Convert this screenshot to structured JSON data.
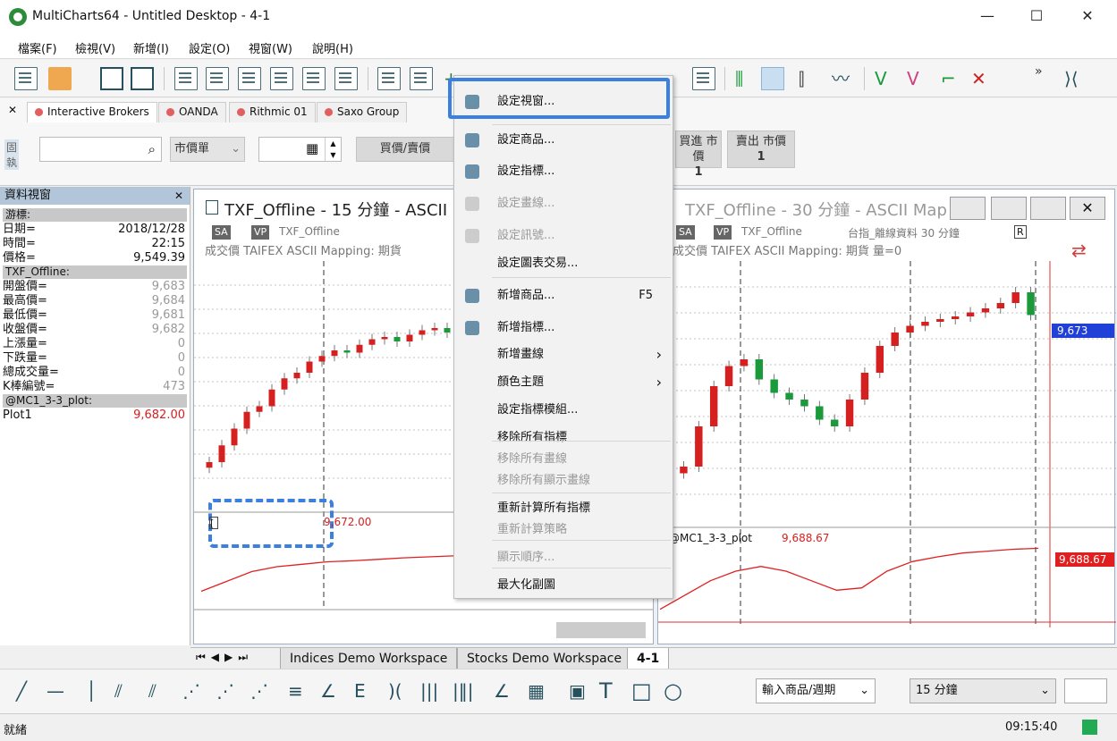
{
  "window": {
    "title": "MultiCharts64 - Untitled Desktop - 4-1",
    "minimize": "—",
    "maximize": "☐",
    "close": "✕"
  },
  "menubar": [
    "檔案(F)",
    "檢視(V)",
    "新增(I)",
    "設定(O)",
    "視窗(W)",
    "說明(H)"
  ],
  "toolbar": {
    "more_glyph": "»"
  },
  "orderbar": {
    "close_glyph": "✕",
    "side_label": "固執",
    "broker_tabs": [
      "Interactive Brokers",
      "OANDA",
      "Rithmic 01",
      "Saxo Group"
    ],
    "order_type": "市價單",
    "buy_sell": "買價/賣價",
    "buy_market": "買進 市價",
    "buy_qty": "1",
    "sell_market": "賣出 市價",
    "sell_qty": "1"
  },
  "datawin": {
    "title": "資料視窗",
    "close_glyph": "✕",
    "cursor_section": "游標:",
    "cursor_rows": [
      {
        "label": "日期=",
        "value": "2018/12/28"
      },
      {
        "label": "時間=",
        "value": "22:15"
      },
      {
        "label": "價格=",
        "value": "9,549.39"
      }
    ],
    "symbol_section": "TXF_Offline:",
    "symbol_rows": [
      {
        "label": "開盤價=",
        "value": "9,683"
      },
      {
        "label": "最高價=",
        "value": "9,684"
      },
      {
        "label": "最低價=",
        "value": "9,681"
      },
      {
        "label": "收盤價=",
        "value": "9,682"
      },
      {
        "label": "上漲量=",
        "value": "0"
      },
      {
        "label": "下跌量=",
        "value": "0"
      },
      {
        "label": "總成交量=",
        "value": "0"
      },
      {
        "label": "K棒編號=",
        "value": "473"
      }
    ],
    "plot_section": "@MC1_3-3_plot:",
    "plot_rows": [
      {
        "label": "Plot1",
        "value": "9,682.00"
      }
    ]
  },
  "chart1": {
    "title": "TXF_Offline - 15 分鐘 - ASCII",
    "chip_sa": "SA",
    "chip_vp": "VP",
    "symbol": "TXF_Offline",
    "ind_box": "[",
    "subtitle": "成交價  TAIFEX  ASCII Mapping: 期貨",
    "plot_value": "9,672.00"
  },
  "chart2": {
    "title": "TXF_Offline - 30 分鐘 - ASCII Map",
    "chip_sa": "SA",
    "chip_vp": "VP",
    "symbol": "TXF_Offline",
    "symbol_desc": "台指_離線資料  30 分鐘",
    "r_box": "R",
    "subtitle": "成交價  TAIFEX  ASCII Mapping: 期貨  量=0",
    "price_tag": "9,673",
    "plot_label": "@MC1_3-3_plot",
    "plot_value": "9,688.67",
    "plot_tag": "9,688.67",
    "close_glyph": "✕"
  },
  "chart_data": [
    {
      "type": "candlestick",
      "title": "TXF_Offline - 15 分鐘 - ASCII",
      "series": [
        {
          "values": [
            9560,
            9575,
            9590,
            9605,
            9610,
            9625,
            9635,
            9640,
            9650,
            9655,
            9660,
            9658,
            9665,
            9670,
            9672,
            9668,
            9674,
            9678,
            9680,
            9676
          ]
        }
      ]
    },
    {
      "type": "candlestick",
      "title": "TXF_Offline - 30 分鐘 - ASCII Map",
      "series": [
        {
          "values": [
            9560,
            9590,
            9620,
            9635,
            9640,
            9625,
            9615,
            9610,
            9605,
            9595,
            9590,
            9610,
            9630,
            9650,
            9660,
            9665,
            9668,
            9670,
            9672,
            9675,
            9678,
            9682,
            9690,
            9673
          ]
        }
      ]
    },
    {
      "type": "line",
      "series": [
        {
          "name": "@MC1_3-3_plot",
          "values": [
            9560,
            9590,
            9620,
            9640,
            9650,
            9640,
            9620,
            9600,
            9605,
            9640,
            9660,
            9670,
            9678,
            9682,
            9686,
            9688
          ]
        }
      ]
    }
  ],
  "context_menu": {
    "items": [
      {
        "label": "設定視窗...",
        "disabled": false,
        "shortcut": "",
        "submenu": false
      },
      {
        "label": "設定商品...",
        "disabled": false,
        "shortcut": "",
        "submenu": false
      },
      {
        "label": "設定指標...",
        "disabled": false,
        "shortcut": "",
        "submenu": false
      },
      {
        "label": "設定畫線...",
        "disabled": true,
        "shortcut": "",
        "submenu": false
      },
      {
        "label": "設定訊號...",
        "disabled": true,
        "shortcut": "",
        "submenu": false
      },
      {
        "label": "設定圖表交易...",
        "disabled": false,
        "shortcut": "",
        "submenu": false
      },
      {
        "label": "新增商品...",
        "disabled": false,
        "shortcut": "F5",
        "submenu": false
      },
      {
        "label": "新增指標...",
        "disabled": false,
        "shortcut": "",
        "submenu": false
      },
      {
        "label": "新增畫線",
        "disabled": false,
        "shortcut": "",
        "submenu": true
      },
      {
        "label": "顏色主題",
        "disabled": false,
        "shortcut": "",
        "submenu": true
      },
      {
        "label": "設定指標模組...",
        "disabled": false,
        "shortcut": "",
        "submenu": false
      },
      {
        "label": "移除所有指標",
        "disabled": false,
        "shortcut": "",
        "submenu": false
      },
      {
        "label": "移除所有畫線",
        "disabled": true,
        "shortcut": "",
        "submenu": false
      },
      {
        "label": "移除所有顯示畫線",
        "disabled": true,
        "shortcut": "",
        "submenu": false
      },
      {
        "label": "重新計算所有指標",
        "disabled": false,
        "shortcut": "",
        "submenu": false
      },
      {
        "label": "重新計算策略",
        "disabled": true,
        "shortcut": "",
        "submenu": false
      },
      {
        "label": "顯示順序...",
        "disabled": true,
        "shortcut": "",
        "submenu": false
      },
      {
        "label": "最大化副圖",
        "disabled": false,
        "shortcut": "",
        "submenu": false
      }
    ],
    "submenu_glyph": "›"
  },
  "workspace_tabs": [
    "Indices Demo Workspace",
    "Stocks Demo Workspace",
    "4-1"
  ],
  "drawbar": {
    "symbol_input": "輸入商品/週期",
    "interval": "15 分鐘",
    "dropdown_glyph": "⌄"
  },
  "statusbar": {
    "status": "就緒",
    "time": "09:15:40",
    "connection_color": "#22aa55"
  },
  "colors": {
    "up_candle": "#d62020",
    "down_candle": "#1a9a3a",
    "indicator_line": "#e02020",
    "highlight": "#3b7fe0"
  }
}
